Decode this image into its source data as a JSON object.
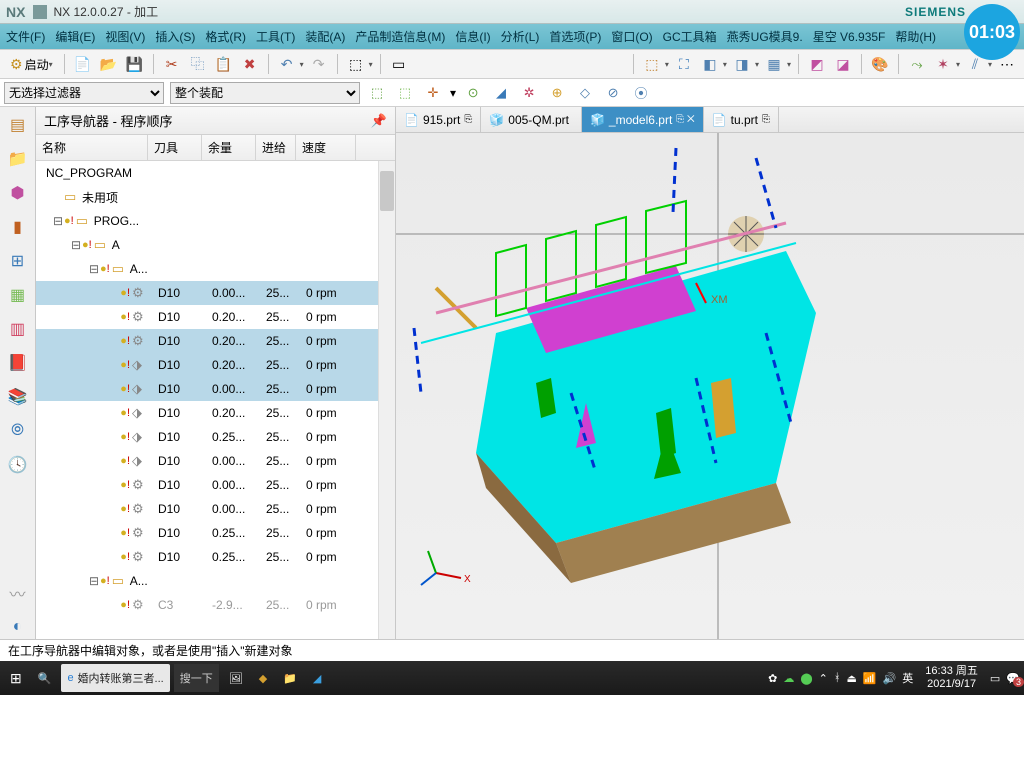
{
  "titlebar": {
    "app": "NX",
    "title": "NX 12.0.0.27 - 加工",
    "brand": "SIEMENS",
    "timer": "01:03"
  },
  "menu": [
    "文件(F)",
    "编辑(E)",
    "视图(V)",
    "插入(S)",
    "格式(R)",
    "工具(T)",
    "装配(A)",
    "产品制造信息(M)",
    "信息(I)",
    "分析(L)",
    "首选项(P)",
    "窗口(O)",
    "GC工具箱",
    "燕秀UG模具9.",
    "星空 V6.935F",
    "帮助(H)"
  ],
  "toolbar": {
    "start": "启动"
  },
  "filters": {
    "filter1": "无选择过滤器",
    "filter2": "整个装配"
  },
  "nav": {
    "title": "工序导航器 - 程序顺序",
    "cols": [
      "名称",
      "刀具",
      "余量",
      "进给",
      "速度"
    ],
    "root": "NC_PROGRAM",
    "unused": "未用项",
    "prog": "PROG...",
    "groupA": "A",
    "subA": "A...",
    "rows": [
      {
        "tool": "D10",
        "rem": "0.00...",
        "feed": "25...",
        "speed": "0 rpm",
        "sel": true,
        "icon": "mill"
      },
      {
        "tool": "D10",
        "rem": "0.20...",
        "feed": "25...",
        "speed": "0 rpm",
        "sel": false,
        "icon": "mill"
      },
      {
        "tool": "D10",
        "rem": "0.20...",
        "feed": "25...",
        "speed": "0 rpm",
        "sel": true,
        "icon": "mill"
      },
      {
        "tool": "D10",
        "rem": "0.20...",
        "feed": "25...",
        "speed": "0 rpm",
        "sel": true,
        "icon": "drill"
      },
      {
        "tool": "D10",
        "rem": "0.00...",
        "feed": "25...",
        "speed": "0 rpm",
        "sel": true,
        "icon": "drill"
      },
      {
        "tool": "D10",
        "rem": "0.20...",
        "feed": "25...",
        "speed": "0 rpm",
        "sel": false,
        "icon": "drill"
      },
      {
        "tool": "D10",
        "rem": "0.25...",
        "feed": "25...",
        "speed": "0 rpm",
        "sel": false,
        "icon": "drill"
      },
      {
        "tool": "D10",
        "rem": "0.00...",
        "feed": "25...",
        "speed": "0 rpm",
        "sel": false,
        "icon": "drill"
      },
      {
        "tool": "D10",
        "rem": "0.00...",
        "feed": "25...",
        "speed": "0 rpm",
        "sel": false,
        "icon": "mill"
      },
      {
        "tool": "D10",
        "rem": "0.00...",
        "feed": "25...",
        "speed": "0 rpm",
        "sel": false,
        "icon": "mill"
      },
      {
        "tool": "D10",
        "rem": "0.25...",
        "feed": "25...",
        "speed": "0 rpm",
        "sel": false,
        "icon": "mill"
      },
      {
        "tool": "D10",
        "rem": "0.25...",
        "feed": "25...",
        "speed": "0 rpm",
        "sel": false,
        "icon": "mill"
      }
    ],
    "group2": "A...",
    "lastrow": {
      "tool": "C3",
      "rem": "-2.9...",
      "feed": "25...",
      "speed": "0 rpm"
    }
  },
  "tabs": [
    {
      "label": "915.prt",
      "icon": "📄",
      "active": false,
      "flag": "⎘"
    },
    {
      "label": "005-QM.prt",
      "icon": "🧊",
      "active": false,
      "flag": ""
    },
    {
      "label": "_model6.prt",
      "icon": "🧊",
      "active": true,
      "flag": "⎘ ✕"
    },
    {
      "label": "tu.prt",
      "icon": "📄",
      "active": false,
      "flag": "⎘"
    }
  ],
  "viewport": {
    "axes": "X",
    "xm": "XM"
  },
  "status": "在工序导航器中编辑对象，或者是使用\"插入\"新建对象",
  "taskbar": {
    "browser": "婚内转账第三者...",
    "search": "搜一下",
    "ime": "英",
    "time": "16:33 周五",
    "date": "2021/9/17",
    "badge": "3"
  }
}
